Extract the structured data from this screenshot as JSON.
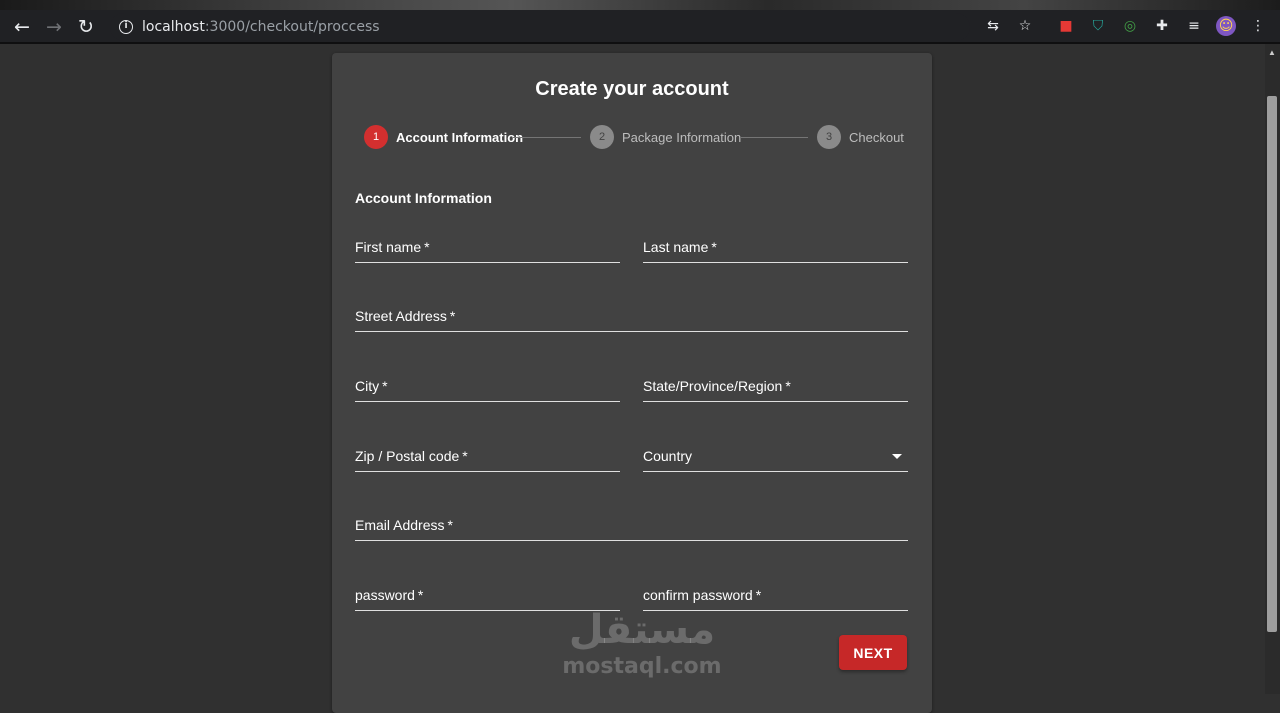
{
  "browser": {
    "url_host": "localhost",
    "url_path": ":3000/checkout/proccess",
    "nav": {
      "back": "←",
      "forward": "→",
      "reload": "↻"
    }
  },
  "form": {
    "title": "Create your account",
    "steps": [
      {
        "number": "1",
        "label": "Account Information",
        "state": "active"
      },
      {
        "number": "2",
        "label": "Package Information",
        "state": "inactive"
      },
      {
        "number": "3",
        "label": "Checkout",
        "state": "inactive"
      }
    ],
    "section_title": "Account Information",
    "required_mark": "*",
    "fields": {
      "first_name": "First name",
      "last_name": "Last name",
      "street_address": "Street Address",
      "city": "City",
      "state_region": "State/Province/Region",
      "zip": "Zip / Postal code",
      "country": "Country",
      "email": "Email Address",
      "password": "password",
      "confirm_password": "confirm password"
    },
    "next_label": "NEXT"
  },
  "watermark": {
    "arabic": "مستقل",
    "latin": "mostaql.com"
  },
  "colors": {
    "accent": "#d32f2f",
    "button": "#c62828",
    "card": "#424242",
    "page": "#303030"
  }
}
